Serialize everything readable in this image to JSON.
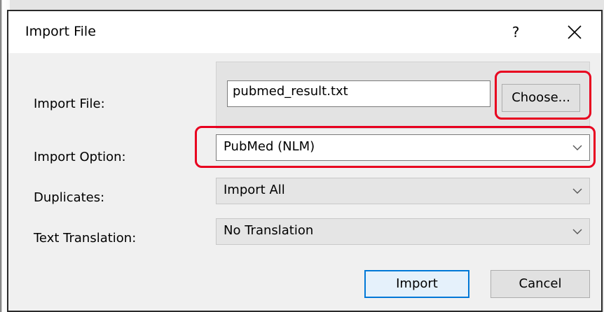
{
  "window": {
    "title": "Import File",
    "help_glyph": "?",
    "close_icon": "close-icon"
  },
  "form": {
    "import_file": {
      "label": "Import File:",
      "value": "pubmed_result.txt",
      "button_label": "Choose..."
    },
    "import_option": {
      "label": "Import Option:",
      "value": "PubMed (NLM)"
    },
    "duplicates": {
      "label": "Duplicates:",
      "value": "Import All"
    },
    "text_translation": {
      "label": "Text Translation:",
      "value": "No Translation"
    }
  },
  "buttons": {
    "import": "Import",
    "cancel": "Cancel"
  },
  "colors": {
    "annotation_red": "#e8001f",
    "focus_blue": "#0078d7"
  }
}
